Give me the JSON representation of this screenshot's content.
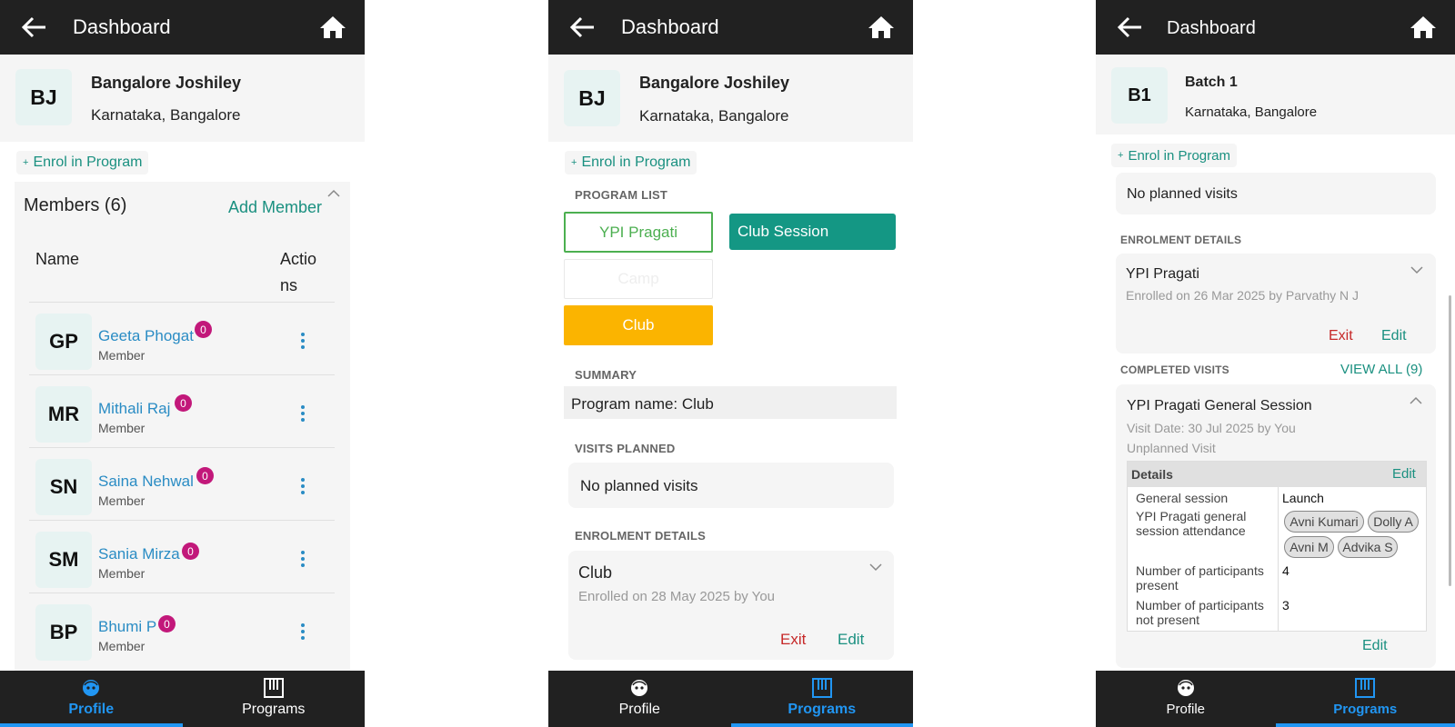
{
  "colors": {
    "appbar": "#212121",
    "accent_teal": "#1a9080",
    "link_blue": "#2a8cc4",
    "nav_active": "#2196f3",
    "badge": "#c2187a",
    "exit_red": "#c62828",
    "club_button": "#fbb400",
    "club_session_button": "#149784",
    "ypi_border": "#4caf50"
  },
  "app": {
    "title": "Dashboard",
    "back_icon": "arrow-left-icon",
    "home_icon": "home-icon"
  },
  "nav": {
    "profile": "Profile",
    "programs": "Programs"
  },
  "screen1": {
    "initials": "BJ",
    "name": "Bangalore Joshiley",
    "location": "Karnataka, Bangalore",
    "enrol": "Enrol in Program",
    "members_title": "Members (6)",
    "add_member": "Add Member",
    "col_name": "Name",
    "col_actions_1": "Actio",
    "col_actions_2": "ns",
    "members": [
      {
        "initials": "GP",
        "name": "Geeta Phogat",
        "role": "Member",
        "count": "0"
      },
      {
        "initials": "MR",
        "name": "Mithali Raj",
        "role": "Member",
        "count": "0"
      },
      {
        "initials": "SN",
        "name": "Saina Nehwal",
        "role": "Member",
        "count": "0"
      },
      {
        "initials": "SM",
        "name": "Sania Mirza",
        "role": "Member",
        "count": "0"
      },
      {
        "initials": "BP",
        "name": "Bhumi P",
        "role": "Member",
        "count": "0"
      }
    ]
  },
  "screen2": {
    "initials": "BJ",
    "name": "Bangalore Joshiley",
    "location": "Karnataka, Bangalore",
    "enrol": "Enrol in Program",
    "program_list_label": "PROGRAM LIST",
    "programs": {
      "ypi": "YPI Pragati",
      "club_session": "Club Session",
      "camp": "Camp",
      "club": "Club"
    },
    "summary_label": "SUMMARY",
    "summary_text": "Program name: Club",
    "visits_planned_label": "VISITS PLANNED",
    "no_visits": "No planned visits",
    "enrolment_label": "ENROLMENT DETAILS",
    "enrolment": {
      "program": "Club",
      "enrolled_on": "Enrolled on 28 May 2025 by You",
      "exit": "Exit",
      "edit": "Edit"
    }
  },
  "screen3": {
    "initials": "B1",
    "name": "Batch 1",
    "location": "Karnataka, Bangalore",
    "enrol": "Enrol in Program",
    "no_visits": "No planned visits",
    "enrolment_label": "ENROLMENT DETAILS",
    "enrolment": {
      "program": "YPI Pragati",
      "enrolled_on": "Enrolled on 26 Mar 2025 by Parvathy N J",
      "exit": "Exit",
      "edit": "Edit"
    },
    "completed_label": "COMPLETED VISITS",
    "view_all": "VIEW ALL (9)",
    "visit": {
      "title": "YPI Pragati General Session",
      "date": "Visit Date: 30 Jul 2025 by You",
      "type": "Unplanned Visit"
    },
    "details": {
      "header": "Details",
      "edit": "Edit",
      "general_session_label": "General session",
      "general_session_value": "Launch",
      "attendance_label_1": "YPI Pragati general",
      "attendance_label_2": "session attendance",
      "attendees": [
        "Avni Kumari",
        "Dolly A",
        "Avni M",
        "Advika S"
      ],
      "present_label_1": "Number of participants",
      "present_label_2": "present",
      "present_value": "4",
      "not_present_label_1": "Number of participants",
      "not_present_label_2": "not present",
      "not_present_value": "3"
    },
    "bottom_edit": "Edit"
  }
}
